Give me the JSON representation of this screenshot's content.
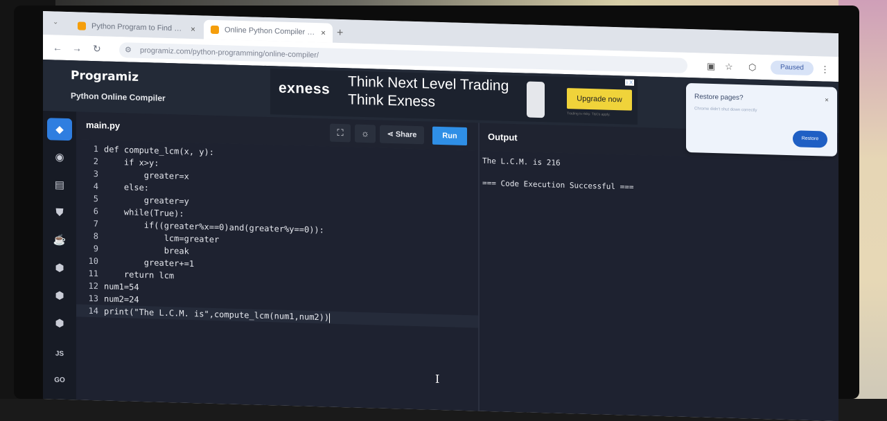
{
  "browser": {
    "tabs": [
      {
        "label": "Python Program to Find LCM"
      },
      {
        "label": "Online Python Compiler (Inter"
      }
    ],
    "new_tab": "+",
    "url": "programiz.com/python-programming/online-compiler/",
    "profile_label": "Paused"
  },
  "app": {
    "logo": "Programiz",
    "subtitle": "Python Online Compiler",
    "filename": "main.py",
    "share_label": "Share",
    "run_label": "Run",
    "output_title": "Output"
  },
  "ad": {
    "brand": "exness",
    "line1": "Think Next Level Trading",
    "line2": "Think Exness",
    "button": "Upgrade now",
    "disclaimer": "Trading is risky. T&Cs apply.",
    "close": "i X"
  },
  "sidebar": {
    "items": [
      {
        "icon": "python-icon"
      },
      {
        "icon": "r-icon"
      },
      {
        "icon": "sql-icon"
      },
      {
        "icon": "html5-icon"
      },
      {
        "icon": "java-icon"
      },
      {
        "icon": "c-icon"
      },
      {
        "icon": "cpp-icon"
      },
      {
        "icon": "csharp-icon"
      },
      {
        "icon": "javascript-icon",
        "label": "JS"
      },
      {
        "icon": "go-icon",
        "label": "GO"
      }
    ]
  },
  "code": {
    "lines": [
      {
        "num": "1",
        "text": "def compute_lcm(x, y):"
      },
      {
        "num": "2",
        "text": "    if x>y:"
      },
      {
        "num": "3",
        "text": "        greater=x"
      },
      {
        "num": "4",
        "text": "    else:"
      },
      {
        "num": "5",
        "text": "        greater=y"
      },
      {
        "num": "6",
        "text": "    while(True):"
      },
      {
        "num": "7",
        "text": "        if((greater%x==0)and(greater%y==0)):"
      },
      {
        "num": "8",
        "text": "            lcm=greater"
      },
      {
        "num": "9",
        "text": "            break"
      },
      {
        "num": "10",
        "text": "        greater+=1"
      },
      {
        "num": "11",
        "text": "    return lcm"
      },
      {
        "num": "12",
        "text": "num1=54"
      },
      {
        "num": "13",
        "text": "num2=24"
      },
      {
        "num": "14",
        "text": "print(\"The L.C.M. is\",compute_lcm(num1,num2))"
      }
    ],
    "active_line": 14
  },
  "output": {
    "lines": [
      "The L.C.M. is 216",
      "",
      "=== Code Execution Successful ==="
    ]
  },
  "restore_popup": {
    "title": "Restore pages?",
    "body": "Chrome didn't shut down correctly",
    "button": "Restore",
    "close": "×"
  },
  "colors": {
    "accent": "#2f8fe6",
    "editor_bg": "#1e2230",
    "ad_button": "#f0d33a"
  }
}
